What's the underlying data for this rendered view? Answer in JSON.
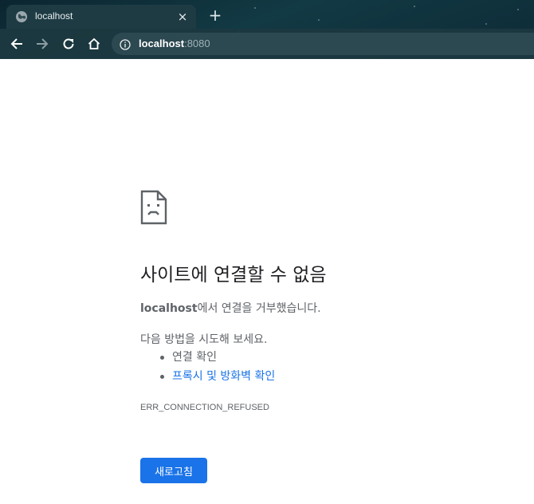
{
  "browser": {
    "tab": {
      "title": "localhost",
      "favicon": "globe-icon",
      "close_label": "×"
    },
    "new_tab_label": "+",
    "toolbar": {
      "back": "back-arrow-icon",
      "forward": "forward-arrow-icon",
      "reload": "reload-icon",
      "home": "home-icon"
    },
    "address": {
      "host": "localhost",
      "port": ":8080",
      "security_icon": "info-icon"
    }
  },
  "error": {
    "icon": "sad-document-icon",
    "title": "사이트에 연결할 수 없음",
    "desc_host": "localhost",
    "desc_rest": "에서 연결을 거부했습니다.",
    "suggest_heading": "다음 방법을 시도해 보세요.",
    "suggestions": [
      {
        "label": "연결 확인",
        "link": false
      },
      {
        "label": "프록시 및 방화벽 확인",
        "link": true
      }
    ],
    "code": "ERR_CONNECTION_REFUSED",
    "reload_label": "새로고침"
  },
  "colors": {
    "accent": "#1a73e8",
    "text_primary": "#202124",
    "text_secondary": "#5f6368"
  }
}
